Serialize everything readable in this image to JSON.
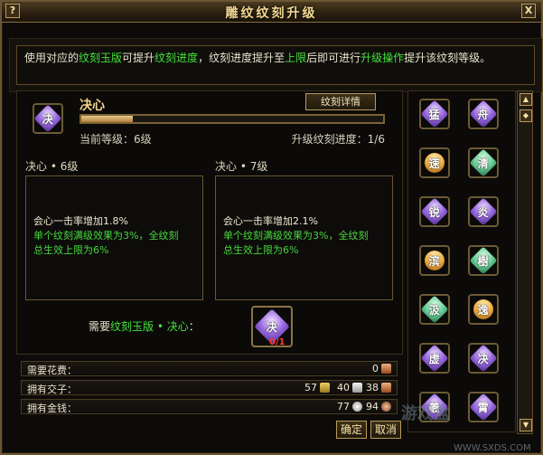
{
  "window": {
    "title": "雕纹纹刻升级",
    "help_label": "?",
    "close_label": "X"
  },
  "description": {
    "p1": "使用对应的",
    "h1": "纹刻玉版",
    "p2": "可提升",
    "h2": "纹刻进度",
    "p3": "，纹刻进度提升至",
    "h3": "上限",
    "p4": "后即可进行",
    "h4": "升级操作",
    "p5": "提升该纹刻等级。"
  },
  "skill": {
    "name": "决心",
    "icon_glyph": "决",
    "progress_fraction": 0.17,
    "current_level": "当前等级：6级",
    "upgrade_progress": "升级纹刻进度：1/6",
    "detail_button": "纹刻详情"
  },
  "current_level_panel": {
    "header": "决心 • 6级",
    "line1": "会心一击率增加1.8%",
    "line2": "单个纹刻满级效果为3%，全纹刻",
    "line3": "总生效上限为6%"
  },
  "next_level_panel": {
    "header": "决心 • 7级",
    "line1": "会心一击率增加2.1%",
    "line2": "单个纹刻满级效果为3%，全纹刻",
    "line3": "总生效上限为6%"
  },
  "requirement": {
    "prefix": "需要",
    "item": "纹刻玉版 • 决心",
    "suffix": "：",
    "item_glyph": "决",
    "item_count": "0/1"
  },
  "resources": {
    "cost_label": "需要花费：",
    "cost_value": "0",
    "jiaozi_label": "拥有交子：",
    "jiaozi_values": [
      "57",
      "40",
      "38"
    ],
    "gold_label": "拥有金钱：",
    "gold_values": [
      "77",
      "94"
    ]
  },
  "buttons": {
    "confirm": "确定",
    "cancel": "取消"
  },
  "grid": {
    "items": [
      {
        "glyph": "猛",
        "style": "purple"
      },
      {
        "glyph": "舟",
        "style": "purple"
      },
      {
        "glyph": "速",
        "style": "gold"
      },
      {
        "glyph": "清",
        "style": "green"
      },
      {
        "glyph": "锐",
        "style": "purple"
      },
      {
        "glyph": "炎",
        "style": "purple"
      },
      {
        "glyph": "滨",
        "style": "gold"
      },
      {
        "glyph": "樹",
        "style": "green"
      },
      {
        "glyph": "汲",
        "style": "green"
      },
      {
        "glyph": "逸",
        "style": "gold"
      },
      {
        "glyph": "虚",
        "style": "purple"
      },
      {
        "glyph": "决",
        "style": "purple"
      },
      {
        "glyph": "羲",
        "style": "purple"
      },
      {
        "glyph": "霄",
        "style": "purple"
      }
    ]
  },
  "watermark": {
    "main": "游戏盒",
    "sub": "WWW.SXDS.COM"
  }
}
